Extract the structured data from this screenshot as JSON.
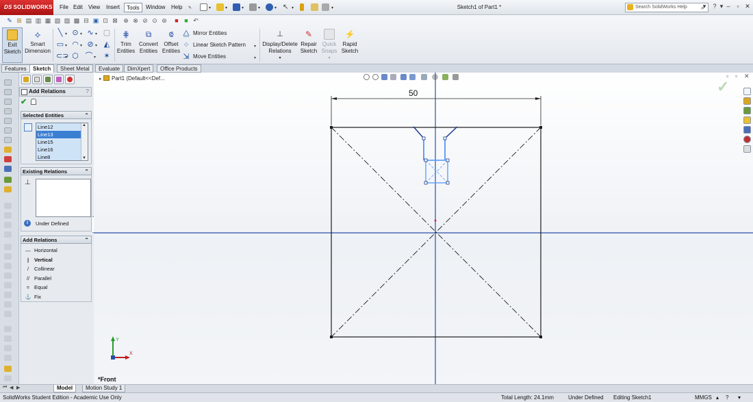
{
  "app": {
    "logo_text": "SOLIDWORKS",
    "logo_ds": "DS",
    "document_title": "Sketch1 of Part1 *"
  },
  "menu": [
    "File",
    "Edit",
    "View",
    "Insert",
    "Tools",
    "Window",
    "Help"
  ],
  "menu_active": "Tools",
  "help_search": {
    "placeholder": "Search SolidWorks Help"
  },
  "ribbon": {
    "exit_sketch": [
      "Exit",
      "Sketch"
    ],
    "smart_dimension": [
      "Smart",
      "Dimension"
    ],
    "trim_entities": [
      "Trim",
      "Entities"
    ],
    "convert_entities": [
      "Convert",
      "Entities"
    ],
    "offset_entities": [
      "Offset",
      "Entities"
    ],
    "mirror_entities": "Mirror Entities",
    "linear_sketch_pattern": "Linear Sketch Pattern",
    "move_entities": "Move Entities",
    "display_delete_relations": [
      "Display/Delete",
      "Relations"
    ],
    "repair_sketch": [
      "Repair",
      "Sketch"
    ],
    "quick_snaps": [
      "Quick",
      "Snaps"
    ],
    "rapid_sketch": [
      "Rapid",
      "Sketch"
    ]
  },
  "command_tabs": [
    "Features",
    "Sketch",
    "Sheet Metal",
    "Evaluate",
    "DimXpert",
    "Office Products"
  ],
  "command_tab_active": "Sketch",
  "property_manager": {
    "title": "Add Relations",
    "help": "?",
    "selected_entities": {
      "header": "Selected Entities",
      "items": [
        "Line12",
        "Line13",
        "Line15",
        "Line16",
        "Line8"
      ],
      "highlighted": "Line13"
    },
    "existing_relations": {
      "header": "Existing Relations",
      "status": "Under Defined"
    },
    "add_relations": {
      "header": "Add Relations",
      "items": [
        {
          "label": "Horizontal",
          "symbol": "—",
          "bold": false
        },
        {
          "label": "Vertical",
          "symbol": "|",
          "bold": true
        },
        {
          "label": "Collinear",
          "symbol": "/",
          "bold": false
        },
        {
          "label": "Parallel",
          "symbol": "//",
          "bold": false
        },
        {
          "label": "Equal",
          "symbol": "=",
          "bold": false
        },
        {
          "label": "Fix",
          "symbol": "⚓",
          "bold": false
        }
      ]
    }
  },
  "feature_tree": {
    "item": "Part1  (Default<<Def..."
  },
  "graphics": {
    "dimension": "50",
    "view_label": "*Front",
    "triad": {
      "y": "Y",
      "x": "X"
    }
  },
  "model_tabs": [
    "Model",
    "Motion Study 1"
  ],
  "model_tab_active": "Model",
  "status_bar": {
    "edition": "SolidWorks Student Edition - Academic Use Only",
    "total_length": "Total Length: 24.1mm",
    "definition": "Under Defined",
    "mode": "Editing Sketch1",
    "units": "MMGS"
  },
  "colors": {
    "accent": "#2a4fa8",
    "sketch_line": "#1a1a1a",
    "selected_line": "#5ca0ff",
    "logo": "#c0191e"
  },
  "icons": [
    "search-icon",
    "check-icon",
    "pin-icon",
    "info-icon",
    "collapse-icon",
    "question-icon",
    "print-icon",
    "close-icon"
  ]
}
